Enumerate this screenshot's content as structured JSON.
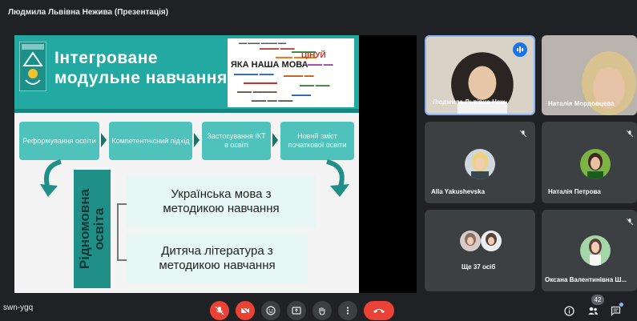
{
  "presenter": {
    "title": "Людмила Львівна Нежива (Презентація)"
  },
  "slide": {
    "title_line1": "Інтегроване",
    "title_line2": "модульне навчання",
    "wordcloud_headline1": "ЯКА НАША МОВА",
    "wordcloud_headline2": "ЦІНУЙ",
    "steps": [
      {
        "label": "Реформування освіти"
      },
      {
        "label": "Компетентнісний підхід"
      },
      {
        "label": "Застосування ІКТ в освіті"
      },
      {
        "label": "Новий зміст початкової освіти"
      }
    ],
    "vertical_label_line1": "Рідномовна",
    "vertical_label_line2": "освіта",
    "box1_line1": "Українська мова з",
    "box1_line2": "методикою навчання",
    "box2_line1": "Дитяча література з",
    "box2_line2": "методикою навчання"
  },
  "participants": [
    {
      "name": "Людмила Львівна Неж...",
      "state": "speaking"
    },
    {
      "name": "Наталія Мордовцева",
      "state": "unknown"
    },
    {
      "name": "Alla Yakushevska",
      "state": "muted"
    },
    {
      "name": "Наталія Петрова",
      "state": "muted"
    },
    {
      "name": "Ще 37 осіб",
      "state": "group"
    },
    {
      "name": "Оксана Валентинівна Ш...",
      "state": "muted"
    }
  ],
  "bottom": {
    "meeting_code": "swn-ygq",
    "participant_count": "42"
  },
  "colors": {
    "meet_bg": "#202124",
    "tile_bg": "#3c4043",
    "danger": "#ea4335",
    "accent": "#1a73e8",
    "slide_teal": "#22a9a2"
  }
}
